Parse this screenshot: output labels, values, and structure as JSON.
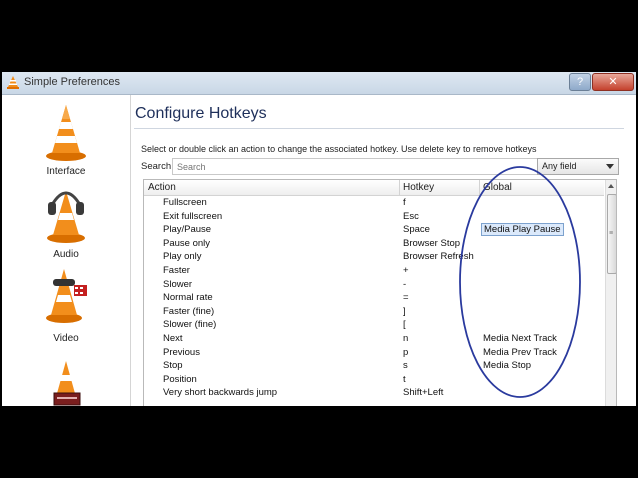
{
  "window": {
    "title": "Simple Preferences",
    "help_label": "?",
    "close_label": "✕"
  },
  "sidebar": {
    "items": [
      {
        "label": "Interface",
        "icon": "vlc-cone-icon"
      },
      {
        "label": "Audio",
        "icon": "headphones-cone-icon"
      },
      {
        "label": "Video",
        "icon": "film-cone-icon"
      },
      {
        "label": "",
        "icon": "subtitles-cone-icon"
      }
    ]
  },
  "main": {
    "heading": "Configure Hotkeys",
    "instructions": "Select or double click an action to change the associated hotkey. Use delete key to remove hotkeys",
    "search_label": "Search",
    "search_placeholder": "Search",
    "field_select": "Any field"
  },
  "table": {
    "columns": [
      "Action",
      "Hotkey",
      "Global"
    ],
    "rows": [
      {
        "action": "Fullscreen",
        "hotkey": "f",
        "global": ""
      },
      {
        "action": "Exit fullscreen",
        "hotkey": "Esc",
        "global": ""
      },
      {
        "action": "Play/Pause",
        "hotkey": "Space",
        "global": "Media Play Pause"
      },
      {
        "action": "Pause only",
        "hotkey": "Browser Stop",
        "global": ""
      },
      {
        "action": "Play only",
        "hotkey": "Browser Refresh",
        "global": ""
      },
      {
        "action": "Faster",
        "hotkey": "+",
        "global": ""
      },
      {
        "action": "Slower",
        "hotkey": "-",
        "global": ""
      },
      {
        "action": "Normal rate",
        "hotkey": "=",
        "global": ""
      },
      {
        "action": "Faster (fine)",
        "hotkey": "]",
        "global": ""
      },
      {
        "action": "Slower (fine)",
        "hotkey": "[",
        "global": ""
      },
      {
        "action": "Next",
        "hotkey": "n",
        "global": "Media Next Track"
      },
      {
        "action": "Previous",
        "hotkey": "p",
        "global": "Media Prev Track"
      },
      {
        "action": "Stop",
        "hotkey": "s",
        "global": "Media Stop"
      },
      {
        "action": "Position",
        "hotkey": "t",
        "global": ""
      },
      {
        "action": "Very short backwards jump",
        "hotkey": "Shift+Left",
        "global": ""
      }
    ]
  },
  "colors": {
    "annotation_ellipse": "#2a3a9e",
    "selection_fill": "#dbe9fb"
  }
}
